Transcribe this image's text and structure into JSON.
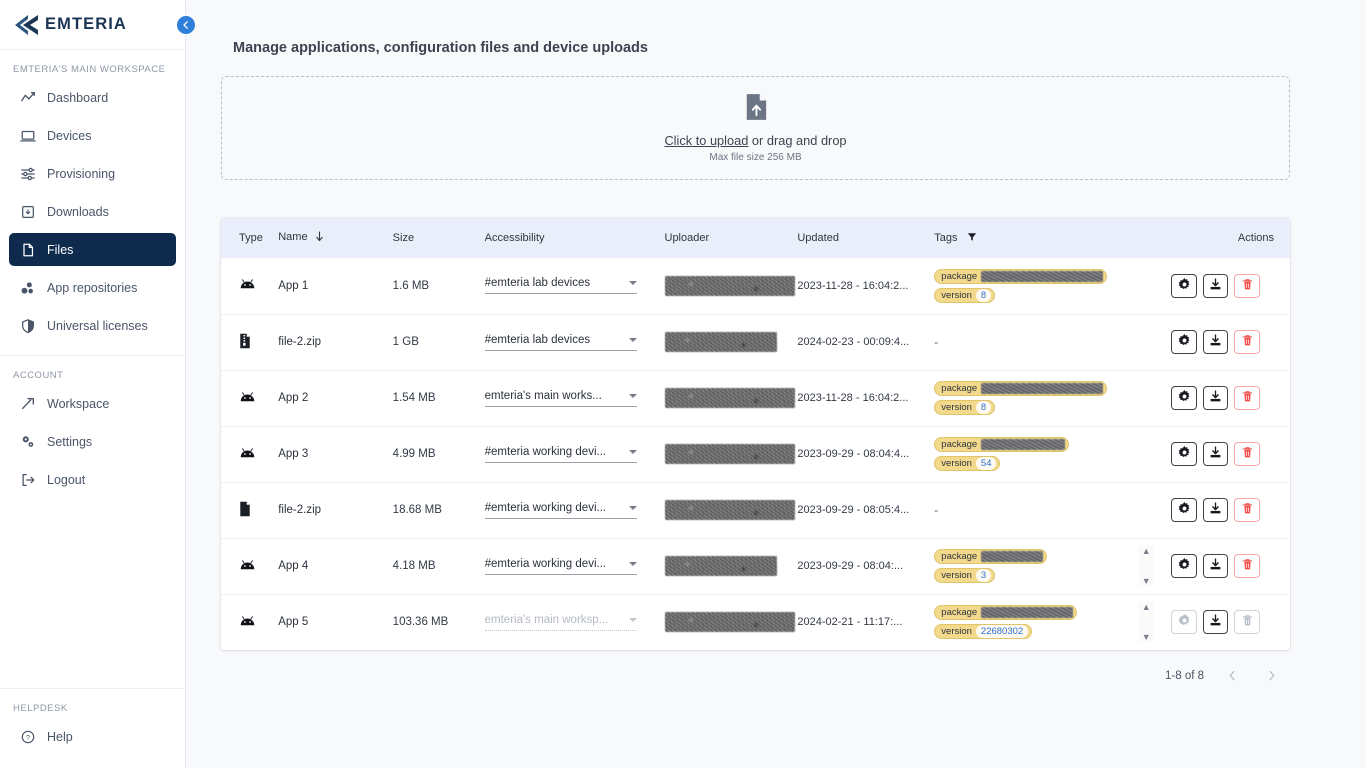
{
  "brand": {
    "name": "EMTERIA",
    "logo_icon": "emteria-chevron-logo"
  },
  "sidebar": {
    "collapse_icon": "chevron-left-icon",
    "workspace_label": "EMTERIA'S MAIN WORKSPACE",
    "account_label": "ACCOUNT",
    "helpdesk_label": "HELPDESK",
    "workspace_items": [
      {
        "label": "Dashboard",
        "icon": "chart-line-icon",
        "active": false
      },
      {
        "label": "Devices",
        "icon": "monitor-icon",
        "active": false
      },
      {
        "label": "Provisioning",
        "icon": "sliders-icon",
        "active": false
      },
      {
        "label": "Downloads",
        "icon": "save-disk-icon",
        "active": false
      },
      {
        "label": "Files",
        "icon": "file-icon",
        "active": true
      },
      {
        "label": "App repositories",
        "icon": "boxes-icon",
        "active": false
      },
      {
        "label": "Universal licenses",
        "icon": "shield-icon",
        "active": false
      }
    ],
    "account_items": [
      {
        "label": "Workspace",
        "icon": "hammer-icon",
        "active": false
      },
      {
        "label": "Settings",
        "icon": "gears-icon",
        "active": false
      },
      {
        "label": "Logout",
        "icon": "logout-icon",
        "active": false
      }
    ],
    "helpdesk_items": [
      {
        "label": "Help",
        "icon": "question-circle-icon",
        "active": false
      }
    ]
  },
  "page": {
    "title": "Manage applications, configuration files and device uploads"
  },
  "dropzone": {
    "icon": "file-upload-icon",
    "link_label": "Click to upload",
    "rest_label": " or drag and drop",
    "hint": "Max file size 256 MB"
  },
  "table": {
    "columns": [
      {
        "key": "type",
        "label": "Type"
      },
      {
        "key": "name",
        "label": "Name",
        "sort_icon": "arrow-down-icon"
      },
      {
        "key": "size",
        "label": "Size"
      },
      {
        "key": "accessibility",
        "label": "Accessibility"
      },
      {
        "key": "uploader",
        "label": "Uploader"
      },
      {
        "key": "updated",
        "label": "Updated"
      },
      {
        "key": "tags",
        "label": "Tags",
        "filter_icon": "funnel-icon"
      },
      {
        "key": "actions",
        "label": "Actions"
      }
    ],
    "rows": [
      {
        "type_icon": "android-icon",
        "name": "App 1",
        "size": "1.6 MB",
        "accessibility": "#emteria lab devices",
        "accessibility_disabled": false,
        "uploader": "",
        "uploader_redacted": true,
        "updated": "2023-11-28 - 16:04:2...",
        "tags": [
          {
            "key": "package",
            "value": "",
            "blurred": true
          },
          {
            "key": "version",
            "value": "8",
            "blurred": false
          }
        ],
        "has_spinner": false,
        "actions": [
          {
            "name": "settings",
            "icon": "gear-icon",
            "style": "normal"
          },
          {
            "name": "download",
            "icon": "download-icon",
            "style": "normal"
          },
          {
            "name": "delete",
            "icon": "trash-icon",
            "style": "danger"
          }
        ]
      },
      {
        "type_icon": "zip-file-icon",
        "name": "file-2.zip",
        "size": "1 GB",
        "accessibility": "#emteria lab devices",
        "accessibility_disabled": false,
        "uploader": "",
        "uploader_redacted": true,
        "updated": "2024-02-23 - 00:09:4...",
        "tags": [],
        "tags_empty": "-",
        "has_spinner": false,
        "actions": [
          {
            "name": "settings",
            "icon": "gear-icon",
            "style": "normal"
          },
          {
            "name": "download",
            "icon": "download-icon",
            "style": "normal"
          },
          {
            "name": "delete",
            "icon": "trash-icon",
            "style": "danger"
          }
        ]
      },
      {
        "type_icon": "android-icon",
        "name": "App 2",
        "size": "1.54 MB",
        "accessibility": "emteria's main works...",
        "accessibility_disabled": false,
        "uploader": "",
        "uploader_redacted": true,
        "updated": "2023-11-28 - 16:04:2...",
        "tags": [
          {
            "key": "package",
            "value": "",
            "blurred": true
          },
          {
            "key": "version",
            "value": "8",
            "blurred": false
          }
        ],
        "has_spinner": false,
        "actions": [
          {
            "name": "settings",
            "icon": "gear-icon",
            "style": "normal"
          },
          {
            "name": "download",
            "icon": "download-icon",
            "style": "normal"
          },
          {
            "name": "delete",
            "icon": "trash-icon",
            "style": "danger"
          }
        ]
      },
      {
        "type_icon": "android-icon",
        "name": "App 3",
        "size": "4.99 MB",
        "accessibility": "#emteria working devi...",
        "accessibility_disabled": false,
        "uploader": "",
        "uploader_redacted": true,
        "updated": "2023-09-29 - 08:04:4...",
        "tags": [
          {
            "key": "package",
            "value": "",
            "blurred": true
          },
          {
            "key": "version",
            "value": "54",
            "blurred": false
          }
        ],
        "has_spinner": false,
        "actions": [
          {
            "name": "settings",
            "icon": "gear-icon",
            "style": "normal"
          },
          {
            "name": "download",
            "icon": "download-icon",
            "style": "normal"
          },
          {
            "name": "delete",
            "icon": "trash-icon",
            "style": "danger"
          }
        ]
      },
      {
        "type_icon": "file-icon",
        "name": "file-2.zip",
        "size": "18.68 MB",
        "accessibility": "#emteria working devi...",
        "accessibility_disabled": false,
        "uploader": "",
        "uploader_redacted": true,
        "updated": "2023-09-29 - 08:05:4...",
        "tags": [],
        "tags_empty": "-",
        "has_spinner": false,
        "actions": [
          {
            "name": "settings",
            "icon": "gear-icon",
            "style": "normal"
          },
          {
            "name": "download",
            "icon": "download-icon",
            "style": "normal"
          },
          {
            "name": "delete",
            "icon": "trash-icon",
            "style": "danger"
          }
        ]
      },
      {
        "type_icon": "android-icon",
        "name": "App 4",
        "size": "4.18 MB",
        "accessibility": "#emteria working devi...",
        "accessibility_disabled": false,
        "uploader": "",
        "uploader_redacted": true,
        "updated": "2023-09-29 - 08:04:...",
        "tags": [
          {
            "key": "package",
            "value": "",
            "blurred": true
          },
          {
            "key": "version",
            "value": "3",
            "blurred": false
          }
        ],
        "has_spinner": true,
        "actions": [
          {
            "name": "settings",
            "icon": "gear-icon",
            "style": "normal"
          },
          {
            "name": "download",
            "icon": "download-icon",
            "style": "normal"
          },
          {
            "name": "delete",
            "icon": "trash-icon",
            "style": "danger"
          }
        ]
      },
      {
        "type_icon": "android-icon",
        "name": "App 5",
        "size": "103.36 MB",
        "accessibility": "emteria's main worksp...",
        "accessibility_disabled": true,
        "uploader": "",
        "uploader_redacted": true,
        "updated": "2024-02-21 - 11:17:...",
        "tags": [
          {
            "key": "package",
            "value": "",
            "blurred": true
          },
          {
            "key": "version",
            "value": "22680302",
            "blurred": false
          }
        ],
        "has_spinner": true,
        "actions": [
          {
            "name": "settings",
            "icon": "gear-icon",
            "style": "muted"
          },
          {
            "name": "download",
            "icon": "download-icon",
            "style": "normal"
          },
          {
            "name": "delete",
            "icon": "trash-icon",
            "style": "muted"
          }
        ]
      }
    ]
  },
  "pagination": {
    "range_label": "1-8 of 8",
    "prev_icon": "chevron-left-icon",
    "next_icon": "chevron-right-icon"
  },
  "colors": {
    "sidebar_active_bg": "#0e2b4d",
    "accent_blue": "#2f7fdb",
    "table_header_bg": "#eaeefa",
    "chip_bg": "#f2d98c",
    "danger": "#f24c4c",
    "page_bg": "#f8f9fb"
  }
}
